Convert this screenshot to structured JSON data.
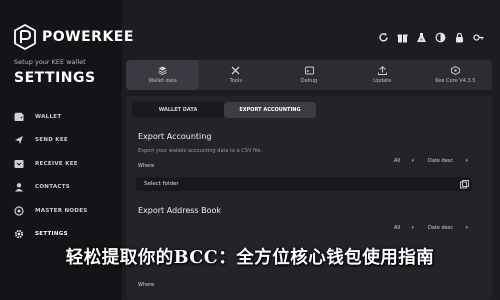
{
  "brand": {
    "name": "POWERKEE"
  },
  "sidebar": {
    "setup_text": "Setup your KEE wallet",
    "title": "SETTINGS",
    "items": [
      {
        "label": "WALLET",
        "icon": "wallet-icon"
      },
      {
        "label": "SEND KEE",
        "icon": "send-icon"
      },
      {
        "label": "RECEIVE KEE",
        "icon": "receive-icon"
      },
      {
        "label": "CONTACTS",
        "icon": "contacts-icon"
      },
      {
        "label": "MASTER NODES",
        "icon": "master-nodes-icon"
      },
      {
        "label": "SETTINGS",
        "icon": "gear-icon",
        "active": true
      }
    ]
  },
  "header_icons": [
    "refresh-icon",
    "gift-icon",
    "flask-icon",
    "contrast-icon",
    "lock-icon",
    "key-icon"
  ],
  "toolbar": {
    "tabs": [
      {
        "label": "Wallet data",
        "icon": "stack-icon",
        "active": true
      },
      {
        "label": "Tools",
        "icon": "tools-icon"
      },
      {
        "label": "Debug",
        "icon": "debug-icon"
      },
      {
        "label": "Update",
        "icon": "update-icon"
      },
      {
        "label": "Kee Core V4.3.5",
        "icon": "kee-core-icon"
      }
    ]
  },
  "subtabs": [
    {
      "label": "WALLET DATA"
    },
    {
      "label": "EXPORT ACCOUNTING",
      "active": true
    }
  ],
  "export_accounting": {
    "title": "Export Accounting",
    "subtitle": "Export your wallets accounting data to a CSV file.",
    "where_label": "Where",
    "filter_value": "All",
    "sort_value": "Date desc",
    "folder_placeholder": "Select folder"
  },
  "export_address_book": {
    "title": "Export Address Book",
    "filter_value": "All",
    "sort_value": "Date desc",
    "where_label": "Where"
  },
  "banner": {
    "text": "轻松提取你的BCC：全方位核心钱包使用指南"
  },
  "colors": {
    "background": "#1c1d22",
    "sidebar": "#131417",
    "panel": "#23242a",
    "accent": "#ffffff"
  }
}
